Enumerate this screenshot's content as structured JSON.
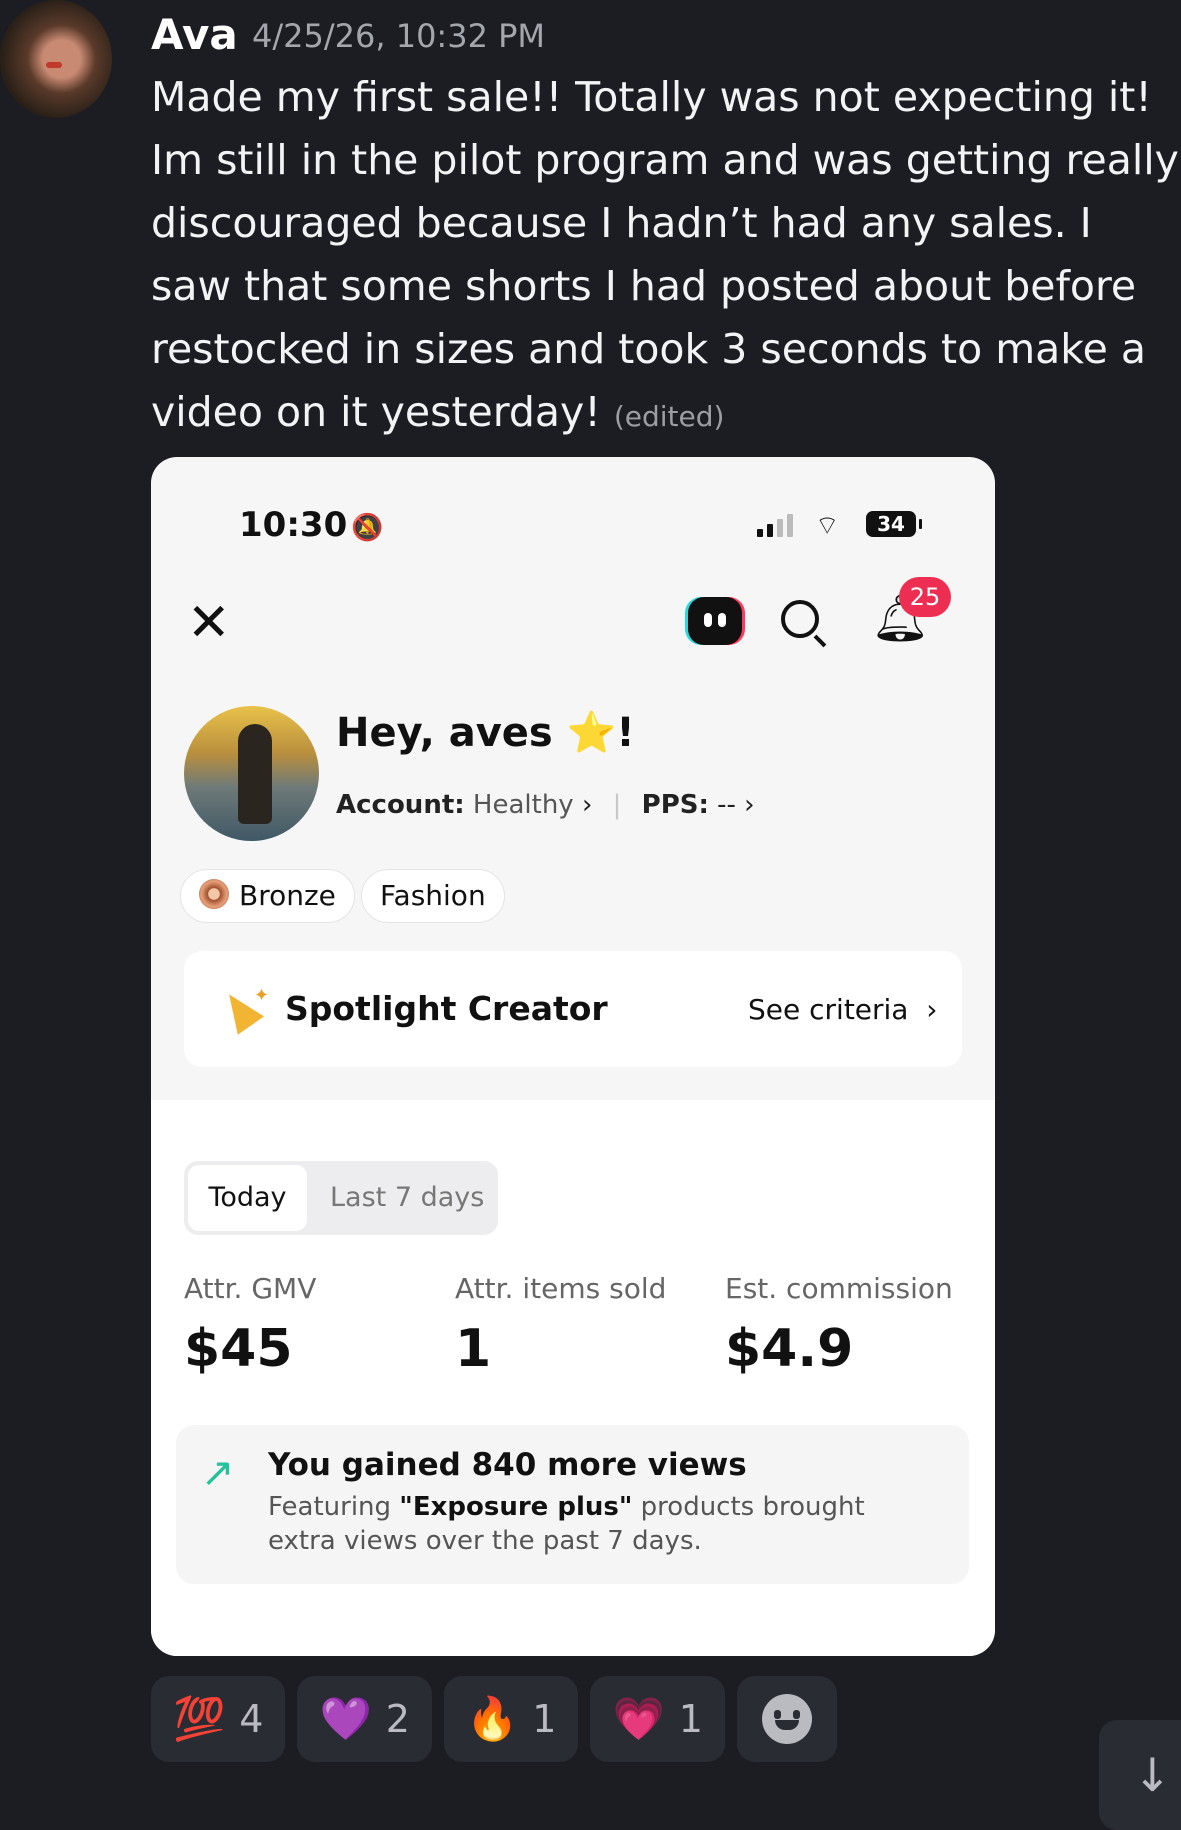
{
  "message": {
    "author": "Ava",
    "timestamp": "4/25/26, 10:32 PM",
    "text": "Made my first sale!! Totally was not expecting it! Im still in the pilot program and was getting really discouraged because I hadn’t had any sales. I saw that some shorts I had posted about before restocked in sizes and took 3 seconds to make a video on it yesterday!",
    "edited_label": "(edited)"
  },
  "screenshot": {
    "status": {
      "time": "10:30",
      "battery": "34"
    },
    "notifications_count": "25",
    "greeting": "Hey, aves ⭐!",
    "account_label": "Account:",
    "account_value": "Healthy",
    "pps_label": "PPS:",
    "pps_value": "--",
    "chips": [
      "Bronze",
      "Fashion"
    ],
    "spotlight": {
      "title": "Spotlight Creator",
      "link": "See criteria"
    },
    "tabs": [
      "Today",
      "Last 7 days"
    ],
    "metrics": [
      {
        "label": "Attr. GMV",
        "value": "$45"
      },
      {
        "label": "Attr. items sold",
        "value": "1"
      },
      {
        "label": "Est. commission",
        "value": "$4.9"
      }
    ],
    "views_card": {
      "title": "You gained 840 more views",
      "desc_prefix": "Featuring ",
      "desc_bold": "\"Exposure plus\"",
      "desc_suffix": " products brought extra views over the past 7 days."
    }
  },
  "reactions": [
    {
      "emoji": "💯",
      "count": "4"
    },
    {
      "emoji": "💜",
      "count": "2"
    },
    {
      "emoji": "🔥",
      "count": "1"
    },
    {
      "emoji": "💗",
      "count": "1"
    }
  ],
  "icons": {
    "close": "close-icon",
    "bot": "bot-icon",
    "search": "search-icon",
    "bell": "bell-icon",
    "add_reaction": "add-reaction-icon",
    "jump": "arrow-down-icon"
  },
  "colors": {
    "background": "#1c1d22",
    "badge": "#ee2d52",
    "trend": "#23c29a"
  }
}
